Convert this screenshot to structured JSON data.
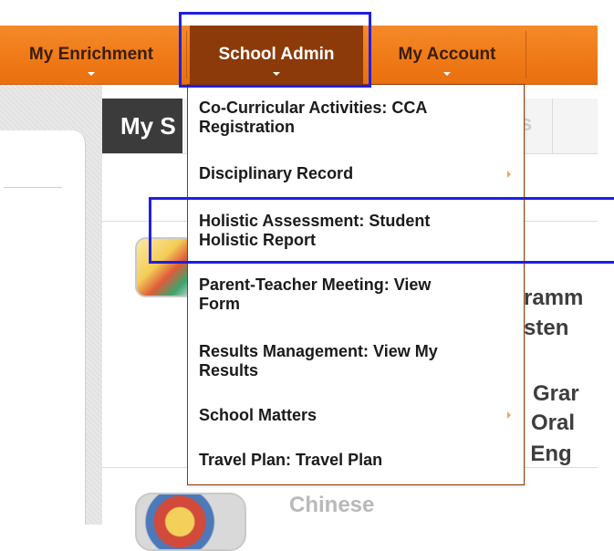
{
  "nav": {
    "items": [
      {
        "label": "My Enrichment"
      },
      {
        "label": "School Admin"
      },
      {
        "label": "My Account"
      }
    ]
  },
  "main": {
    "tab_label": "My S",
    "ghost_tab": "s",
    "course_fragments": [
      "ramm",
      "sten",
      "Grar",
      "Oral",
      "n Eng"
    ],
    "next_course": "Chinese"
  },
  "menu": {
    "items": [
      {
        "line1": "Co-Curricular Activities: CCA",
        "line2": "Registration"
      },
      {
        "line1": "Disciplinary Record",
        "line2": ""
      },
      {
        "line1": "Holistic Assessment: Student",
        "line2": "Holistic Report"
      },
      {
        "line1": "Parent-Teacher Meeting: View",
        "line2": "Form"
      },
      {
        "line1": "Results Management: View My",
        "line2": "Results"
      },
      {
        "line1": "School Matters",
        "line2": ""
      },
      {
        "line1": "Travel Plan: Travel Plan",
        "line2": ""
      }
    ]
  },
  "colors": {
    "nav_orange": "#f07a17",
    "nav_active": "#8c3a09",
    "highlight_blue": "#1f1fe0"
  }
}
